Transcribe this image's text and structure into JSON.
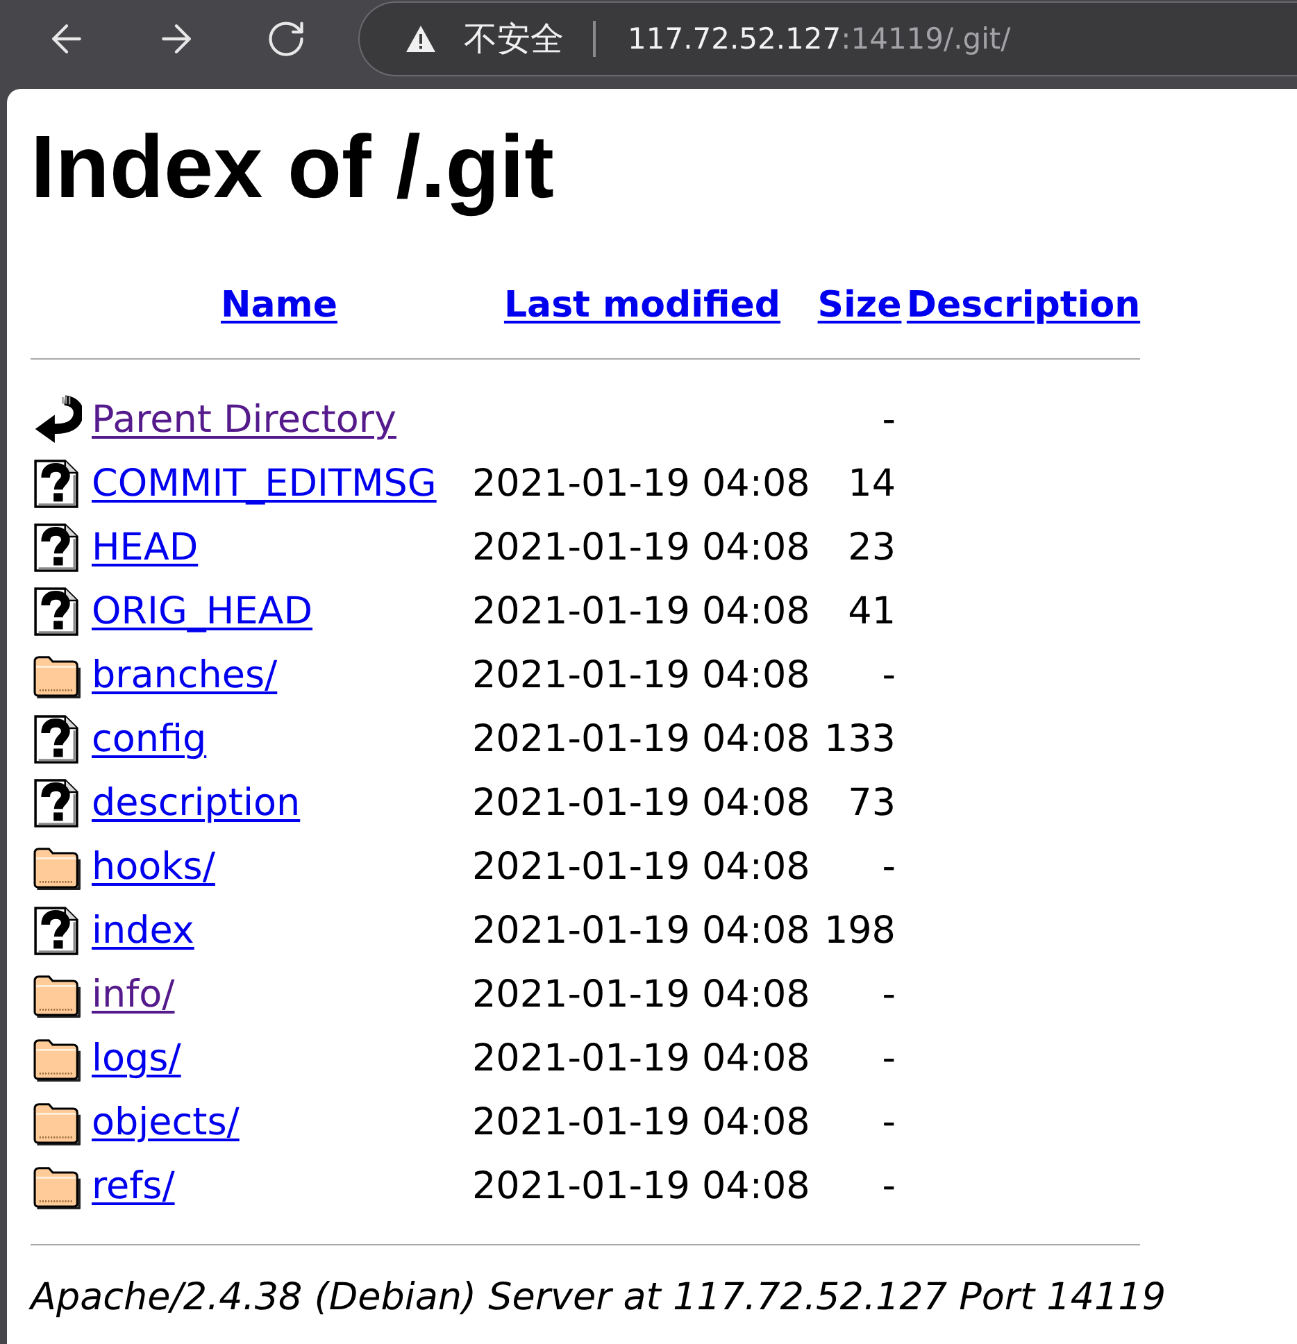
{
  "address_bar": {
    "security_label": "不安全",
    "url_host": "117.72.52.127",
    "url_rest": ":14119/.git/"
  },
  "page": {
    "title": "Index of /.git",
    "columns": [
      {
        "label": "Name"
      },
      {
        "label": "Last modified"
      },
      {
        "label": "Size"
      },
      {
        "label": "Description"
      }
    ],
    "rows": [
      {
        "kind": "parent",
        "name": "Parent Directory",
        "size": "-",
        "visited": true
      },
      {
        "kind": "file",
        "name": "COMMIT_EDITMSG",
        "modified": "2021-01-19 04:08",
        "size": "14",
        "visited": false
      },
      {
        "kind": "file",
        "name": "HEAD",
        "modified": "2021-01-19 04:08",
        "size": "23",
        "visited": false
      },
      {
        "kind": "file",
        "name": "ORIG_HEAD",
        "modified": "2021-01-19 04:08",
        "size": "41",
        "visited": false
      },
      {
        "kind": "folder",
        "name": "branches/",
        "modified": "2021-01-19 04:08",
        "size": "-",
        "visited": false
      },
      {
        "kind": "file",
        "name": "config",
        "modified": "2021-01-19 04:08",
        "size": "133",
        "visited": false
      },
      {
        "kind": "file",
        "name": "description",
        "modified": "2021-01-19 04:08",
        "size": "73",
        "visited": false
      },
      {
        "kind": "folder",
        "name": "hooks/",
        "modified": "2021-01-19 04:08",
        "size": "-",
        "visited": false
      },
      {
        "kind": "file",
        "name": "index",
        "modified": "2021-01-19 04:08",
        "size": "198",
        "visited": false
      },
      {
        "kind": "folder",
        "name": "info/",
        "modified": "2021-01-19 04:08",
        "size": "-",
        "visited": true
      },
      {
        "kind": "folder",
        "name": "logs/",
        "modified": "2021-01-19 04:08",
        "size": "-",
        "visited": false
      },
      {
        "kind": "folder",
        "name": "objects/",
        "modified": "2021-01-19 04:08",
        "size": "-",
        "visited": false
      },
      {
        "kind": "folder",
        "name": "refs/",
        "modified": "2021-01-19 04:08",
        "size": "-",
        "visited": false
      }
    ],
    "footer": "Apache/2.4.38 (Debian) Server at 117.72.52.127 Port 14119"
  }
}
